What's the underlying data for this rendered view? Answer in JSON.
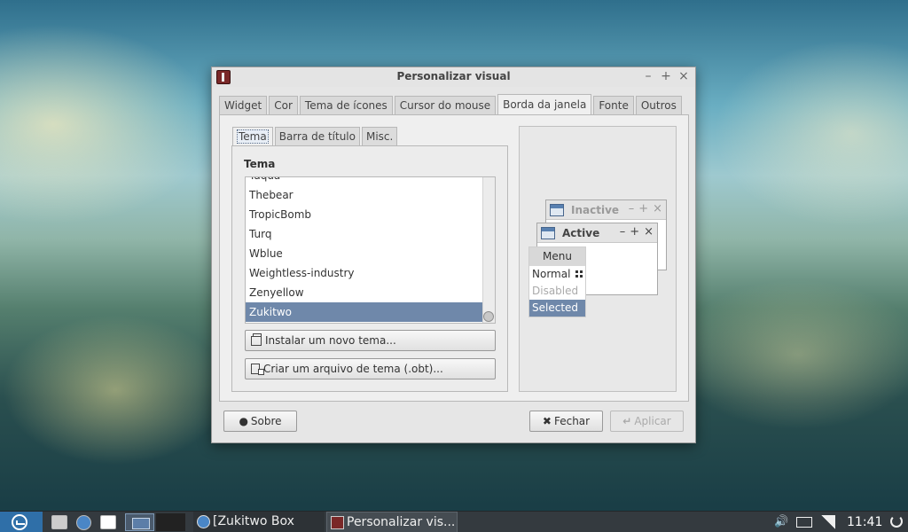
{
  "window": {
    "title": "Personalizar visual",
    "controls": [
      "–",
      "+",
      "×"
    ]
  },
  "tabs": [
    "Widget",
    "Cor",
    "Tema de ícones",
    "Cursor do mouse",
    "Borda da janela",
    "Fonte",
    "Outros"
  ],
  "active_tab": "Borda da janela",
  "subtabs": [
    "Tema",
    "Barra de título",
    "Misc."
  ],
  "active_subtab": "Tema",
  "theme_section": {
    "label": "Tema",
    "items": [
      "Taqua",
      "Thebear",
      "TropicBomb",
      "Turq",
      "Wblue",
      "Weightless-industry",
      "Zenyellow",
      "Zukitwo"
    ],
    "selected": "Zukitwo",
    "install_button": "Instalar um novo tema...",
    "create_button": "Criar um arquivo de tema (.obt)..."
  },
  "preview": {
    "inactive_label": "Inactive",
    "active_label": "Active",
    "controls": [
      "–",
      "+",
      "×"
    ],
    "menu_title": "Menu",
    "menu_items": {
      "normal": "Normal",
      "disabled": "Disabled",
      "selected": "Selected"
    }
  },
  "buttons": {
    "about": "Sobre",
    "close": "Fechar",
    "apply": "Aplicar"
  },
  "taskbar": {
    "tasks": [
      "[Zukitwo Box Bo...",
      "Personalizar vis..."
    ],
    "clock": "11:41"
  }
}
